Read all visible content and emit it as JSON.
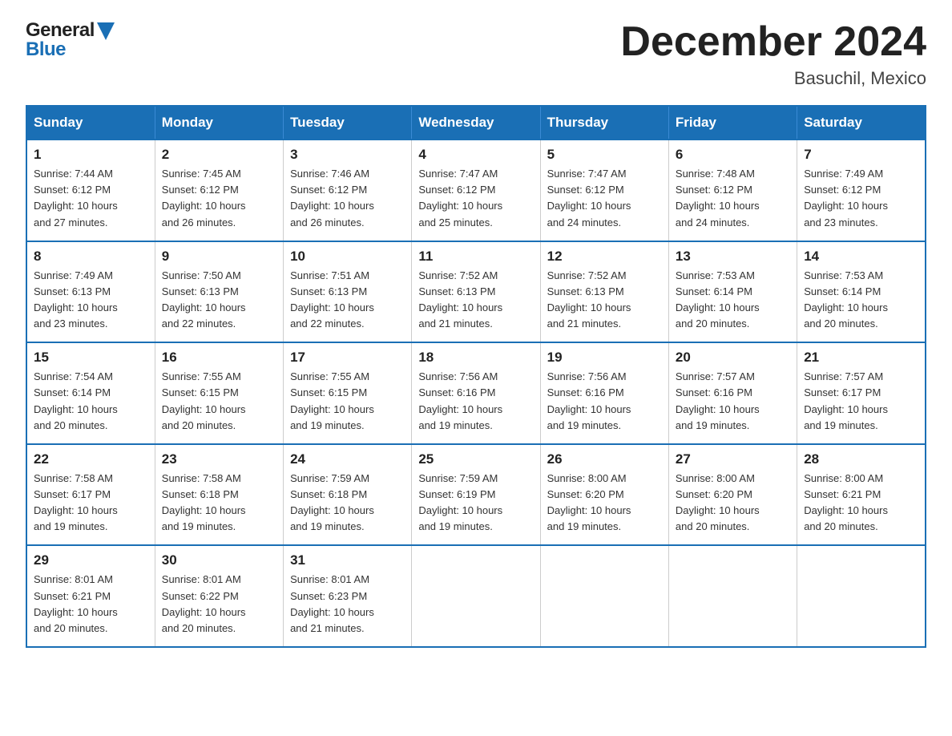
{
  "header": {
    "logo_general": "General",
    "logo_blue": "Blue",
    "month_title": "December 2024",
    "location": "Basuchil, Mexico"
  },
  "weekdays": [
    "Sunday",
    "Monday",
    "Tuesday",
    "Wednesday",
    "Thursday",
    "Friday",
    "Saturday"
  ],
  "weeks": [
    [
      {
        "day": "1",
        "sunrise": "7:44 AM",
        "sunset": "6:12 PM",
        "daylight": "10 hours and 27 minutes."
      },
      {
        "day": "2",
        "sunrise": "7:45 AM",
        "sunset": "6:12 PM",
        "daylight": "10 hours and 26 minutes."
      },
      {
        "day": "3",
        "sunrise": "7:46 AM",
        "sunset": "6:12 PM",
        "daylight": "10 hours and 26 minutes."
      },
      {
        "day": "4",
        "sunrise": "7:47 AM",
        "sunset": "6:12 PM",
        "daylight": "10 hours and 25 minutes."
      },
      {
        "day": "5",
        "sunrise": "7:47 AM",
        "sunset": "6:12 PM",
        "daylight": "10 hours and 24 minutes."
      },
      {
        "day": "6",
        "sunrise": "7:48 AM",
        "sunset": "6:12 PM",
        "daylight": "10 hours and 24 minutes."
      },
      {
        "day": "7",
        "sunrise": "7:49 AM",
        "sunset": "6:12 PM",
        "daylight": "10 hours and 23 minutes."
      }
    ],
    [
      {
        "day": "8",
        "sunrise": "7:49 AM",
        "sunset": "6:13 PM",
        "daylight": "10 hours and 23 minutes."
      },
      {
        "day": "9",
        "sunrise": "7:50 AM",
        "sunset": "6:13 PM",
        "daylight": "10 hours and 22 minutes."
      },
      {
        "day": "10",
        "sunrise": "7:51 AM",
        "sunset": "6:13 PM",
        "daylight": "10 hours and 22 minutes."
      },
      {
        "day": "11",
        "sunrise": "7:52 AM",
        "sunset": "6:13 PM",
        "daylight": "10 hours and 21 minutes."
      },
      {
        "day": "12",
        "sunrise": "7:52 AM",
        "sunset": "6:13 PM",
        "daylight": "10 hours and 21 minutes."
      },
      {
        "day": "13",
        "sunrise": "7:53 AM",
        "sunset": "6:14 PM",
        "daylight": "10 hours and 20 minutes."
      },
      {
        "day": "14",
        "sunrise": "7:53 AM",
        "sunset": "6:14 PM",
        "daylight": "10 hours and 20 minutes."
      }
    ],
    [
      {
        "day": "15",
        "sunrise": "7:54 AM",
        "sunset": "6:14 PM",
        "daylight": "10 hours and 20 minutes."
      },
      {
        "day": "16",
        "sunrise": "7:55 AM",
        "sunset": "6:15 PM",
        "daylight": "10 hours and 20 minutes."
      },
      {
        "day": "17",
        "sunrise": "7:55 AM",
        "sunset": "6:15 PM",
        "daylight": "10 hours and 19 minutes."
      },
      {
        "day": "18",
        "sunrise": "7:56 AM",
        "sunset": "6:16 PM",
        "daylight": "10 hours and 19 minutes."
      },
      {
        "day": "19",
        "sunrise": "7:56 AM",
        "sunset": "6:16 PM",
        "daylight": "10 hours and 19 minutes."
      },
      {
        "day": "20",
        "sunrise": "7:57 AM",
        "sunset": "6:16 PM",
        "daylight": "10 hours and 19 minutes."
      },
      {
        "day": "21",
        "sunrise": "7:57 AM",
        "sunset": "6:17 PM",
        "daylight": "10 hours and 19 minutes."
      }
    ],
    [
      {
        "day": "22",
        "sunrise": "7:58 AM",
        "sunset": "6:17 PM",
        "daylight": "10 hours and 19 minutes."
      },
      {
        "day": "23",
        "sunrise": "7:58 AM",
        "sunset": "6:18 PM",
        "daylight": "10 hours and 19 minutes."
      },
      {
        "day": "24",
        "sunrise": "7:59 AM",
        "sunset": "6:18 PM",
        "daylight": "10 hours and 19 minutes."
      },
      {
        "day": "25",
        "sunrise": "7:59 AM",
        "sunset": "6:19 PM",
        "daylight": "10 hours and 19 minutes."
      },
      {
        "day": "26",
        "sunrise": "8:00 AM",
        "sunset": "6:20 PM",
        "daylight": "10 hours and 19 minutes."
      },
      {
        "day": "27",
        "sunrise": "8:00 AM",
        "sunset": "6:20 PM",
        "daylight": "10 hours and 20 minutes."
      },
      {
        "day": "28",
        "sunrise": "8:00 AM",
        "sunset": "6:21 PM",
        "daylight": "10 hours and 20 minutes."
      }
    ],
    [
      {
        "day": "29",
        "sunrise": "8:01 AM",
        "sunset": "6:21 PM",
        "daylight": "10 hours and 20 minutes."
      },
      {
        "day": "30",
        "sunrise": "8:01 AM",
        "sunset": "6:22 PM",
        "daylight": "10 hours and 20 minutes."
      },
      {
        "day": "31",
        "sunrise": "8:01 AM",
        "sunset": "6:23 PM",
        "daylight": "10 hours and 21 minutes."
      },
      null,
      null,
      null,
      null
    ]
  ],
  "labels": {
    "sunrise": "Sunrise:",
    "sunset": "Sunset:",
    "daylight": "Daylight:"
  }
}
